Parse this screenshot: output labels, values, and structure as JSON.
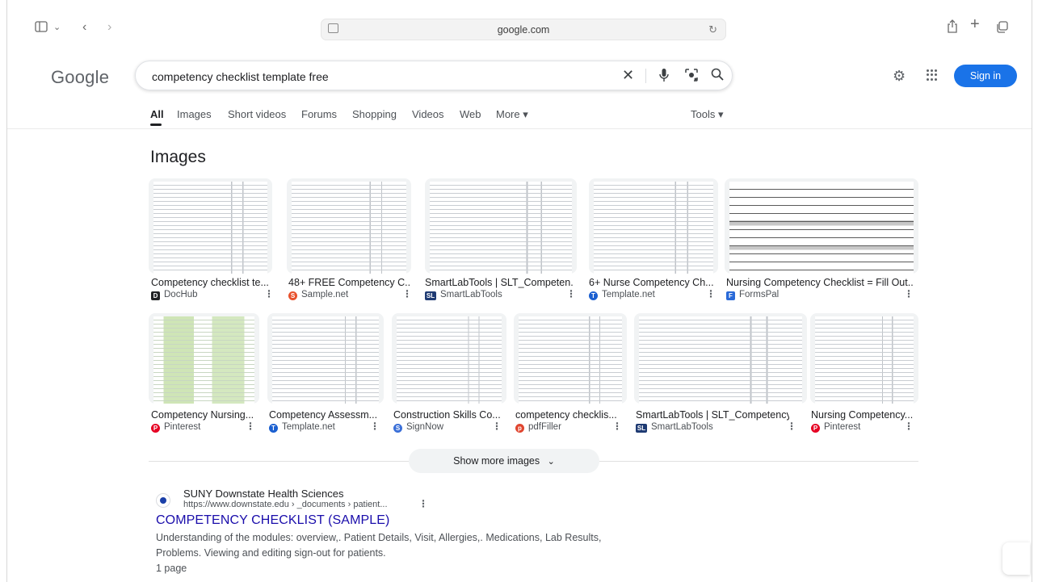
{
  "browser": {
    "url": "google.com"
  },
  "google": {
    "logo": "Google",
    "query": "competency checklist template free",
    "sign_in": "Sign in"
  },
  "tabs": [
    {
      "label": "All",
      "active": true
    },
    {
      "label": "Images"
    },
    {
      "label": "Short videos"
    },
    {
      "label": "Forums"
    },
    {
      "label": "Shopping"
    },
    {
      "label": "Videos"
    },
    {
      "label": "Web"
    },
    {
      "label": "More ▾"
    }
  ],
  "tools_label": "Tools ▾",
  "images": {
    "title": "Images",
    "row1": [
      {
        "caption": "Competency checklist te...",
        "source": "DocHub",
        "icon_color": "#202124"
      },
      {
        "caption": "48+ FREE Competency C...",
        "source": "Sample.net",
        "icon_color": "#e8512c"
      },
      {
        "caption": "SmartLabTools | SLT_Competen...",
        "source": "SmartLabTools",
        "icon_color": "#1f3b73"
      },
      {
        "caption": "6+ Nurse Competency Ch...",
        "source": "Template.net",
        "icon_color": "#1a5fd0"
      },
      {
        "caption": "Nursing Competency Checklist = Fill Out...",
        "source": "FormsPal",
        "icon_color": "#2a6ad8"
      }
    ],
    "row2": [
      {
        "caption": "Competency Nursing...",
        "source": "Pinterest",
        "icon_color": "#e60023"
      },
      {
        "caption": "Competency Assessm...",
        "source": "Template.net",
        "icon_color": "#1a5fd0"
      },
      {
        "caption": "Construction Skills Co...",
        "source": "SignNow",
        "icon_color": "#3a6fd8"
      },
      {
        "caption": "competency checklis...",
        "source": "pdfFiller",
        "icon_color": "#e0452f"
      },
      {
        "caption": "SmartLabTools | SLT_Competency ...",
        "source": "SmartLabTools",
        "icon_color": "#1f3b73"
      },
      {
        "caption": "Nursing Competency...",
        "source": "Pinterest",
        "icon_color": "#e60023"
      }
    ],
    "show_more": "Show more images"
  },
  "result": {
    "site": "SUNY Downstate Health Sciences",
    "url": "https://www.downstate.edu › _documents › patient...",
    "title": "COMPETENCY CHECKLIST (SAMPLE)",
    "snippet_1": "Understanding of the modules: overview,. Patient Details, Visit, Allergies,. Medications, Lab Results,",
    "snippet_2": "Problems. Viewing and editing sign-out for patients.",
    "snippet_3": "1 page"
  },
  "colors": {
    "link": "#1a0dab",
    "accent": "#1a73e8"
  }
}
